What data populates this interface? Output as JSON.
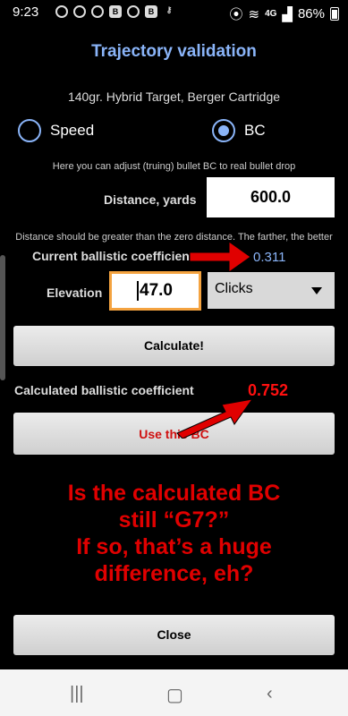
{
  "status": {
    "time": "9:23",
    "network": "4G",
    "battery": "86%"
  },
  "title": "Trajectory validation",
  "cartridge": "140gr. Hybrid Target, Berger Cartridge",
  "radio": {
    "speed_label": "Speed",
    "bc_label": "BC",
    "selected": "BC"
  },
  "hint_bc": "Here you can adjust (truing) bullet BC to real bullet drop",
  "distance": {
    "label": "Distance, yards",
    "value": "600.0"
  },
  "hint_distance": "Distance should be greater than the zero distance. The farther, the better",
  "current_bc": {
    "label": "Current ballistic coefficient",
    "value": "0.311"
  },
  "elevation": {
    "label": "Elevation",
    "value": "47.0",
    "unit_selected": "Clicks"
  },
  "calculate_button": "Calculate!",
  "calculated_bc": {
    "label": "Calculated ballistic coefficient",
    "value": "0.752"
  },
  "use_bc_button": "Use this BC",
  "annotation": {
    "line1": "Is the calculated BC",
    "line2": "still “G7?”",
    "line3": "If so, that’s a huge",
    "line4": "difference, eh?"
  },
  "close_button": "Close",
  "colors": {
    "accent": "#8ab4f8",
    "annotation_red": "#e00000",
    "input_focus": "#f4a340"
  }
}
